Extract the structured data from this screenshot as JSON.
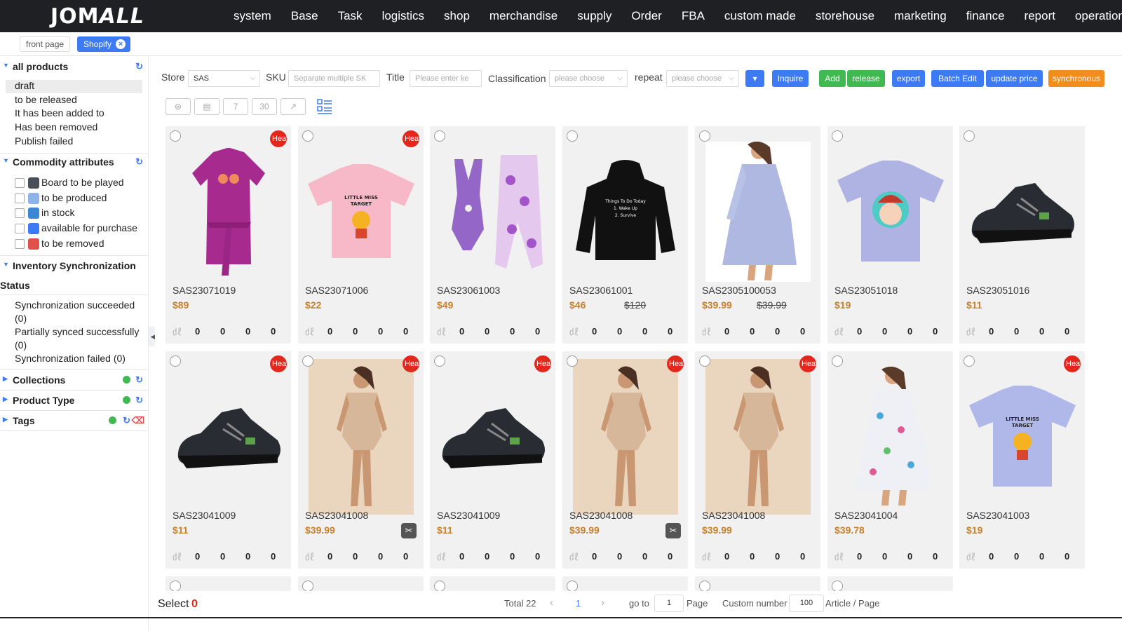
{
  "header": {
    "logo_left": "JOM",
    "logo_right": "ALL",
    "nav": [
      "system",
      "Base",
      "Task",
      "logistics",
      "shop",
      "merchandise",
      "supply",
      "Order",
      "FBA",
      "custom made",
      "storehouse",
      "marketing",
      "finance",
      "report",
      "operation"
    ]
  },
  "tabs": {
    "front": "front page",
    "active": "Shopify",
    "close_icon": "×"
  },
  "sidebar": {
    "all_products": "all products",
    "product_states": [
      "draft",
      "to be released",
      "It has been added to",
      "Has been removed",
      "Publish failed"
    ],
    "commodity_attributes": "Commodity attributes",
    "attributes": [
      {
        "label": "Board to be played",
        "icon": "board-icon",
        "color": "#4a4f5a"
      },
      {
        "label": "to be produced",
        "icon": "produce-icon",
        "color": "#8fb3e8"
      },
      {
        "label": "in stock",
        "icon": "stock-icon",
        "color": "#3a87d6"
      },
      {
        "label": "available for purchase",
        "icon": "cart-icon",
        "color": "#3d7bf5"
      },
      {
        "label": "to be removed",
        "icon": "remove-icon",
        "color": "#e0514b"
      }
    ],
    "inventory_sync": "Inventory Synchronization",
    "status": "Status",
    "sync_items": [
      [
        "Synchronization succeeded",
        "(0)"
      ],
      [
        "Partially synced successfully",
        "(0)"
      ],
      [
        "Synchronization failed (0)"
      ]
    ],
    "collections": "Collections",
    "product_type": "Product Type",
    "tags": "Tags"
  },
  "filters": {
    "store_label": "Store",
    "store_value": "SAS",
    "sku_label": "SKU",
    "sku_placeholder": "Separate multiple SK",
    "title_label": "Title",
    "title_placeholder": "Please enter ke",
    "classification_label": "Classification",
    "classification_placeholder": "please choose",
    "repeat_label": "repeat",
    "repeat_placeholder": "please choose"
  },
  "buttons": [
    {
      "label": "▾",
      "color": "#3d7bf5"
    },
    {
      "label": "Inquire",
      "color": "#3d7bf5"
    },
    {
      "label": "Add",
      "color": "#3fb950"
    },
    {
      "label": "release",
      "color": "#3fb950"
    },
    {
      "label": "export",
      "color": "#3d7bf5"
    },
    {
      "label": "Batch Edit",
      "color": "#3d7bf5"
    },
    {
      "label": "update price",
      "color": "#3d7bf5"
    },
    {
      "label": "synchronous",
      "color": "#f28c1a"
    }
  ],
  "hot_badge": "Heat",
  "products": [
    {
      "sku": "SAS23071019",
      "price": "$89",
      "old": "",
      "hot": true,
      "img": "dress-purple",
      "stats": [
        "0",
        "0",
        "0",
        "0"
      ]
    },
    {
      "sku": "SAS23071006",
      "price": "$22",
      "old": "",
      "hot": true,
      "img": "tee-pink",
      "stats": [
        "0",
        "0",
        "0",
        "0"
      ]
    },
    {
      "sku": "SAS23061003",
      "price": "$49",
      "old": "",
      "hot": false,
      "img": "swimsuit",
      "stats": [
        "0",
        "0",
        "0",
        "0"
      ]
    },
    {
      "sku": "SAS23061001",
      "price": "$46",
      "old": "$120",
      "hot": false,
      "img": "hoodie",
      "stats": [
        "0",
        "0",
        "0",
        "0"
      ]
    },
    {
      "sku": "SAS2305100053",
      "price": "$39.99",
      "old": "$39.99",
      "hot": false,
      "img": "dress-blue",
      "stats": [
        "0",
        "0",
        "0",
        "0"
      ]
    },
    {
      "sku": "SAS23051018",
      "price": "$19",
      "old": "",
      "hot": false,
      "img": "tee-lavender",
      "stats": [
        "0",
        "0",
        "0",
        "0"
      ]
    },
    {
      "sku": "SAS23051016",
      "price": "$11",
      "old": "",
      "hot": false,
      "img": "shoe",
      "stats": [
        "0",
        "0",
        "0",
        "0"
      ]
    },
    {
      "sku": "SAS23041009",
      "price": "$11",
      "old": "",
      "hot": true,
      "img": "shoe",
      "stats": [
        "0",
        "0",
        "0",
        "0"
      ]
    },
    {
      "sku": "SAS23041008",
      "price": "$39.99",
      "old": "",
      "hot": true,
      "img": "shapewear",
      "scissors": true,
      "stats": [
        "0",
        "0",
        "0",
        "0"
      ]
    },
    {
      "sku": "SAS23041009",
      "price": "$11",
      "old": "",
      "hot": true,
      "img": "shoe",
      "stats": [
        "0",
        "0",
        "0",
        "0"
      ]
    },
    {
      "sku": "SAS23041008",
      "price": "$39.99",
      "old": "",
      "hot": true,
      "img": "shapewear",
      "scissors": true,
      "stats": [
        "0",
        "0",
        "0",
        "0"
      ]
    },
    {
      "sku": "SAS23041008",
      "price": "$39.99",
      "old": "",
      "hot": true,
      "img": "shapewear",
      "stats": [
        "0",
        "0",
        "0",
        "0"
      ]
    },
    {
      "sku": "SAS23041004",
      "price": "$39.78",
      "old": "",
      "hot": false,
      "img": "dress-floral",
      "stats": [
        "0",
        "0",
        "0",
        "0"
      ]
    },
    {
      "sku": "SAS23041003",
      "price": "$19",
      "old": "",
      "hot": true,
      "img": "tee-blue",
      "stats": [
        "0",
        "0",
        "0",
        "0"
      ]
    }
  ],
  "footer": {
    "select_label": "Select",
    "select_count": "0",
    "total": "Total 22",
    "prev": "‹",
    "page": "1",
    "next": "›",
    "goto": "go to",
    "goto_value": "1",
    "page_label": "Page",
    "custom_number": "Custom number",
    "per_page": "100",
    "article_page": "Article / Page"
  }
}
